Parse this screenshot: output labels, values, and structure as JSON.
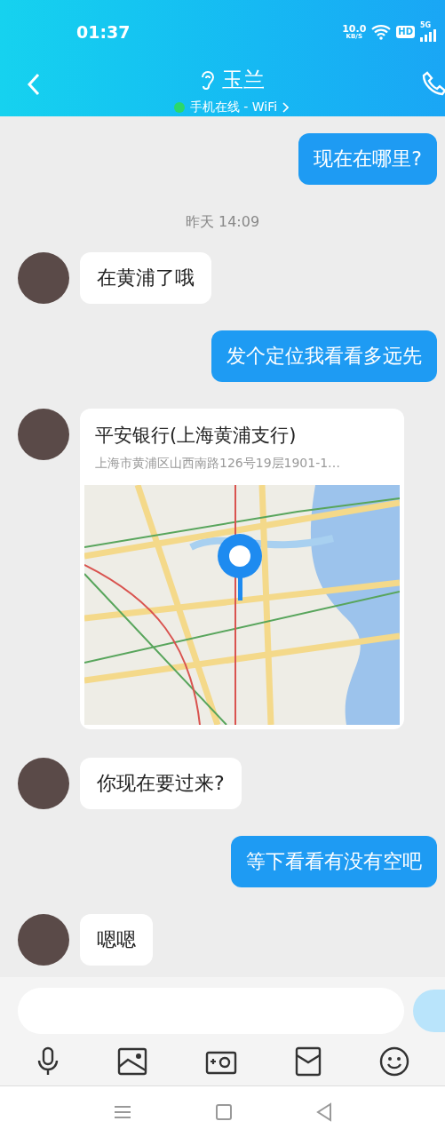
{
  "status_bar": {
    "time": "01:37",
    "speed_value": "10.0",
    "speed_unit": "KB/S",
    "hd_badge": "HD",
    "network": "5G"
  },
  "header": {
    "title": "玉兰",
    "presence": "手机在线 - WiFi",
    "online": true
  },
  "messages": [
    {
      "kind": "sent",
      "text": "现在在哪里?"
    },
    {
      "kind": "time",
      "text": "昨天 14:09"
    },
    {
      "kind": "received",
      "text": "在黄浦了哦"
    },
    {
      "kind": "sent",
      "text": "发个定位我看看多远先"
    },
    {
      "kind": "location",
      "title": "平安银行(上海黄浦支行)",
      "address": "上海市黄浦区山西南路126号19层1901-1…"
    },
    {
      "kind": "received",
      "text": "你现在要过来?"
    },
    {
      "kind": "sent",
      "text": "等下看看有没有空吧"
    },
    {
      "kind": "received",
      "text": "嗯嗯"
    }
  ]
}
